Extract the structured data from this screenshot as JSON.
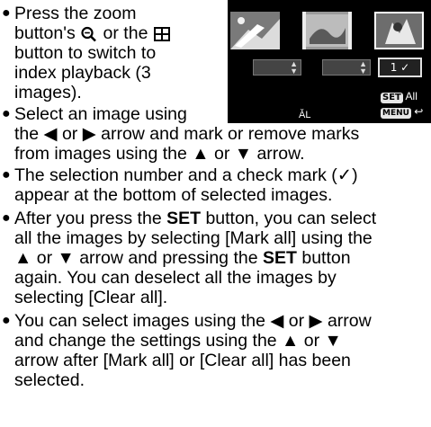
{
  "bullets": [
    {
      "lines": [
        {
          "pre": "Press the zoom"
        },
        {
          "pre": "button's",
          "post": "or the"
        },
        {
          "pre": "button to switch to"
        },
        {
          "pre": "index playback (3"
        },
        {
          "pre": "images)."
        }
      ]
    },
    {
      "lines": [
        {
          "pre": "Select an image using"
        },
        {
          "pre": "the ◀ or ▶ arrow and mark or remove marks"
        },
        {
          "pre": "from images using the ▲ or ▼ arrow."
        }
      ]
    },
    {
      "lines": [
        {
          "pre": "The selection number and a check mark (✓)"
        },
        {
          "pre": "appear at the bottom of selected images."
        }
      ]
    },
    {
      "lines": [
        {
          "pre": "After you press the",
          "bold": "SET",
          "post": "button, you can select"
        },
        {
          "pre": "all the images by selecting [Mark all] using the"
        },
        {
          "pre": "▲ or ▼ arrow and pressing the",
          "bold": "SET",
          "post": "button"
        },
        {
          "pre": "again. You can deselect all the images by"
        },
        {
          "pre": "selecting [Clear all]."
        }
      ]
    },
    {
      "lines": [
        {
          "pre": "You can select images using the ◀ or ▶ arrow"
        },
        {
          "pre": "and change the settings using the ▲ or ▼"
        },
        {
          "pre": "arrow after [Mark all] or [Clear all] has been"
        },
        {
          "pre": "selected."
        }
      ]
    }
  ],
  "bullet_glyph": "●",
  "icons": {
    "zoom": "zoom-magnifier-icon",
    "index": "index-playback-icon"
  },
  "screen": {
    "selected_value": "1 ✓",
    "selected_arrows": "⬍",
    "set_label": "SET",
    "set_action": "All",
    "menu_label": "MENU",
    "menu_icon": "return-arrow-icon",
    "corner_label": "ǍL"
  },
  "colors": {
    "screen_bg": "#000000",
    "text": "#000000"
  }
}
